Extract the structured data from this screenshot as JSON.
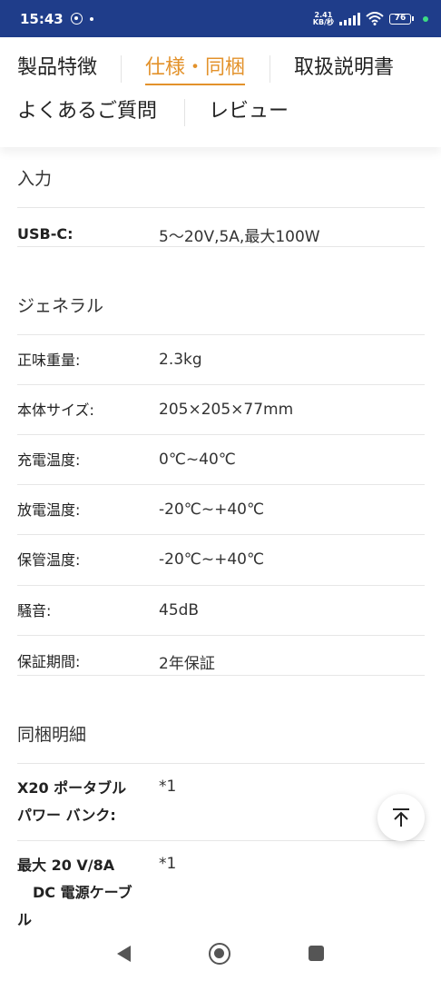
{
  "status_bar": {
    "time": "15:43",
    "net_speed_value": "2.41",
    "net_speed_unit": "KB/秒",
    "battery_level": "76",
    "background_color": "#1f3d8a"
  },
  "tabs": {
    "features": "製品特徴",
    "specs": "仕様・同梱",
    "manual": "取扱説明書",
    "faq": "よくあるご質問",
    "reviews": "レビュー",
    "active_color": "#e3922b"
  },
  "input_section": {
    "title": "入力",
    "usb_c_label": "USB-C:",
    "usb_c_value": "5〜20V,5A,最大100W"
  },
  "general_section": {
    "title": "ジェネラル",
    "weight_label": "正味重量:",
    "weight_value": "2.3kg",
    "size_label": "本体サイズ:",
    "size_value": "205×205×77mm",
    "charge_temp_label": "充電温度:",
    "charge_temp_value": "0℃~40℃",
    "discharge_temp_label": "放電温度:",
    "discharge_temp_value": "-20℃~+40℃",
    "storage_temp_label": "保管温度:",
    "storage_temp_value": "-20℃~+40℃",
    "noise_label": "騒音:",
    "noise_value": "45dB",
    "warranty_label": "保証期間:",
    "warranty_value": "2年保証"
  },
  "package_section": {
    "title": "同梱明細",
    "item1_label_line1": "X20 ポータブル",
    "item1_label_line2": "パワー バンク:",
    "item1_value": "*1",
    "item2_label_line1": "最大 20 V/8A",
    "item2_label_line2": "DC 電源ケーブ",
    "item2_label_line3": "ル",
    "item2_value": "*1"
  },
  "icons": {
    "scroll_top": "arrow-to-top-icon",
    "back": "triangle-back-icon",
    "home": "circle-home-icon",
    "recent": "square-recent-icon"
  }
}
